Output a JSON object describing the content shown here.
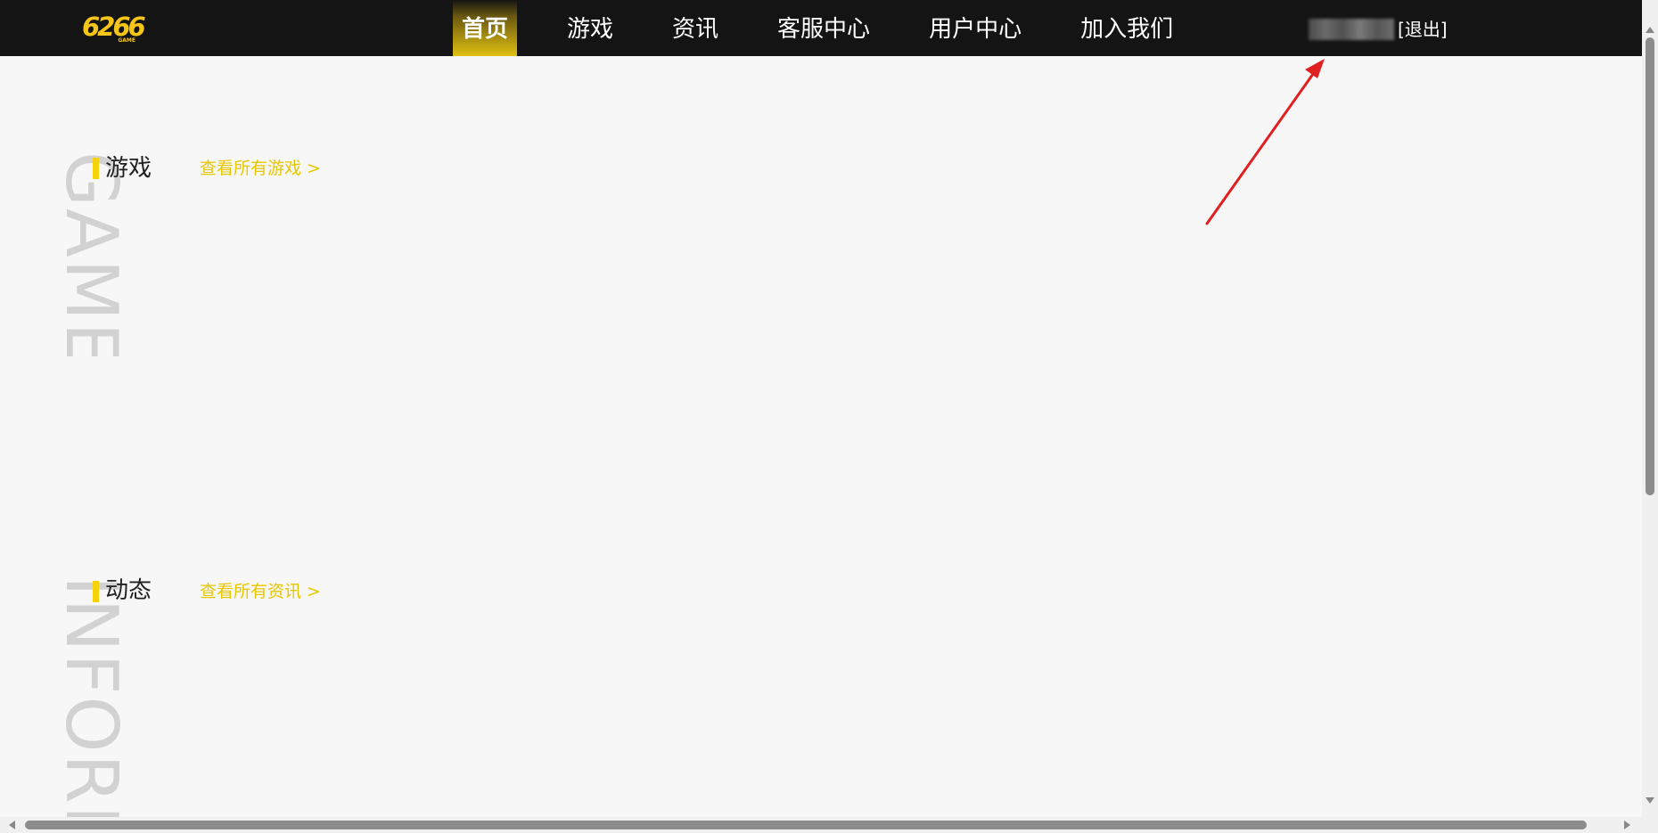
{
  "brand": {
    "logo_text": "6266",
    "logo_sub": "GAME",
    "color": "#f5c518"
  },
  "nav": {
    "items": [
      {
        "label": "首页",
        "active": true
      },
      {
        "label": "游戏",
        "active": false
      },
      {
        "label": "资讯",
        "active": false
      },
      {
        "label": "客服中心",
        "active": false
      },
      {
        "label": "用户中心",
        "active": false
      },
      {
        "label": "加入我们",
        "active": false
      }
    ],
    "active_color": "#e0c010",
    "background": "#141414"
  },
  "user": {
    "logout_label": "[退出]"
  },
  "sections": {
    "games": {
      "watermark": "GAME",
      "title": "游戏",
      "link_label": "查看所有游戏 >"
    },
    "news": {
      "watermark": "INFORMATION",
      "title": "动态",
      "link_label": "查看所有资讯 >"
    }
  },
  "annotation": {
    "type": "arrow",
    "color": "#e02020"
  }
}
